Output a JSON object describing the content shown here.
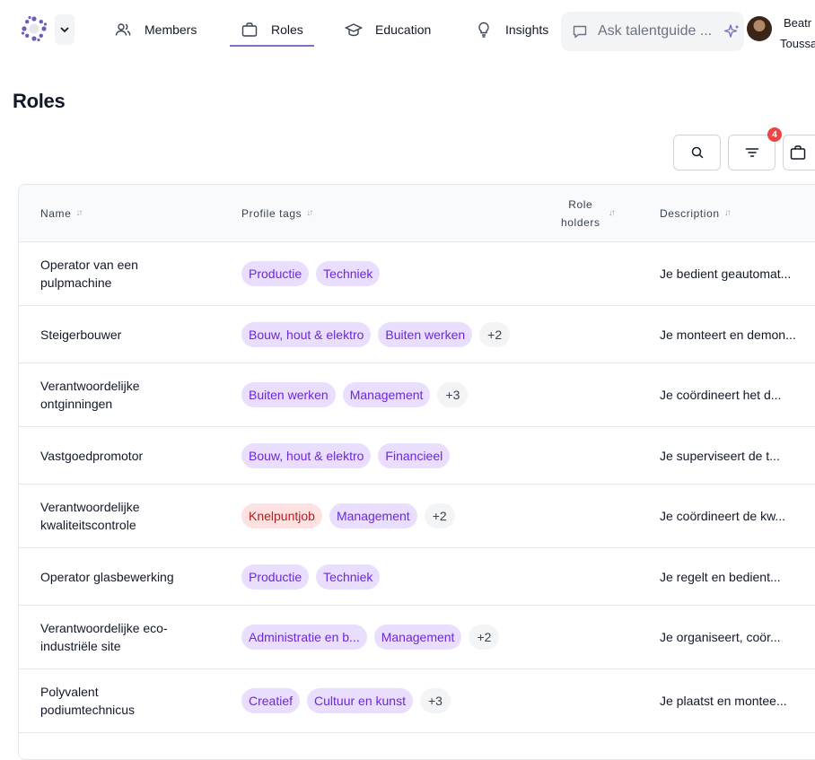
{
  "nav": {
    "items": [
      {
        "label": "Members",
        "icon": "users-icon"
      },
      {
        "label": "Roles",
        "icon": "briefcase-icon",
        "active": true
      },
      {
        "label": "Education",
        "icon": "graduation-cap-icon"
      },
      {
        "label": "Insights",
        "icon": "lightbulb-icon"
      }
    ],
    "ask_placeholder": "Ask talentguide ...",
    "user_first": "Beatr",
    "user_last": "Toussa"
  },
  "page": {
    "title": "Roles",
    "filter_count": "4"
  },
  "table": {
    "headers": {
      "name": "Name",
      "tags": "Profile tags",
      "holders_line1": "Role",
      "holders_line2": "holders",
      "description": "Description"
    },
    "rows": [
      {
        "name_line1": "Operator van een",
        "name_line2": "pulpmachine",
        "tags": [
          {
            "label": "Productie"
          },
          {
            "label": "Techniek"
          }
        ],
        "more": "",
        "description": "Je bedient geautomat..."
      },
      {
        "name_line1": "Steigerbouwer",
        "name_line2": "",
        "tags": [
          {
            "label": "Bouw, hout & elektro"
          },
          {
            "label": "Buiten werken"
          }
        ],
        "more": "+2",
        "description": "Je monteert en demon..."
      },
      {
        "name_line1": "Verantwoordelijke",
        "name_line2": "ontginningen",
        "tags": [
          {
            "label": "Buiten werken"
          },
          {
            "label": "Management"
          }
        ],
        "more": "+3",
        "description": "Je coördineert het d..."
      },
      {
        "name_line1": "Vastgoedpromotor",
        "name_line2": "",
        "tags": [
          {
            "label": "Bouw, hout & elektro"
          },
          {
            "label": "Financieel"
          }
        ],
        "more": "",
        "description": "Je superviseert de t..."
      },
      {
        "name_line1": "Verantwoordelijke",
        "name_line2": "kwaliteitscontrole",
        "tags": [
          {
            "label": "Knelpuntjob",
            "color": "red"
          },
          {
            "label": "Management"
          }
        ],
        "more": "+2",
        "description": "Je coördineert de kw..."
      },
      {
        "name_line1": "Operator glasbewerking",
        "name_line2": "",
        "tags": [
          {
            "label": "Productie"
          },
          {
            "label": "Techniek"
          }
        ],
        "more": "",
        "description": "Je regelt en bedient..."
      },
      {
        "name_line1": "Verantwoordelijke eco-",
        "name_line2": "industriële site",
        "tags": [
          {
            "label": "Administratie en b..."
          },
          {
            "label": "Management"
          }
        ],
        "more": "+2",
        "description": "Je organiseert, coör..."
      },
      {
        "name_line1": "Polyvalent",
        "name_line2": "podiumtechnicus",
        "tags": [
          {
            "label": "Creatief"
          },
          {
            "label": "Cultuur en kunst"
          }
        ],
        "more": "+3",
        "description": "Je plaatst en montee..."
      }
    ]
  },
  "colors": {
    "accent": "#7c6fc4",
    "tag_bg": "#e9defd",
    "tag_text": "#6d28d9",
    "alert_tag_bg": "#fee2e2",
    "alert_tag_text": "#b91c1c",
    "badge": "#ef4444"
  }
}
